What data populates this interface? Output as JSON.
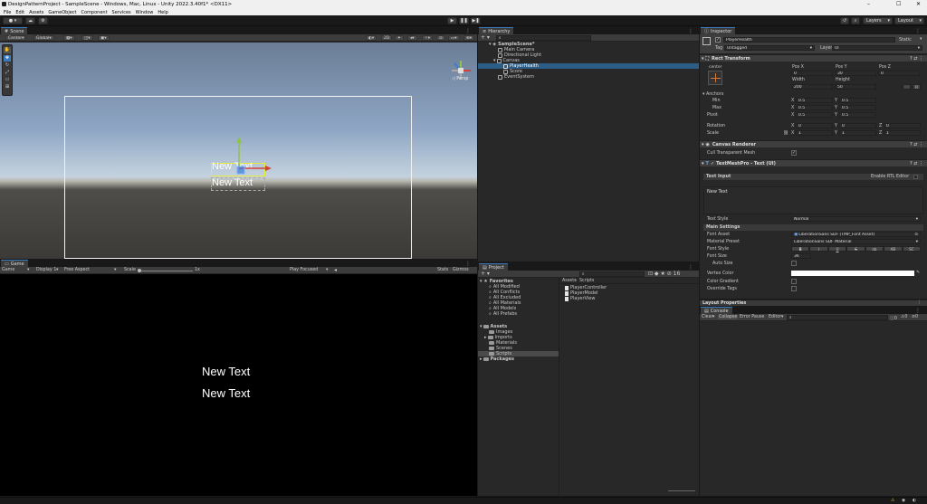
{
  "window": {
    "title": "DesignPatternProject - SampleScene - Windows, Mac, Linux - Unity 2022.3.40f1* <DX11>"
  },
  "menu": [
    "File",
    "Edit",
    "Assets",
    "GameObject",
    "Component",
    "Services",
    "Window",
    "Help"
  ],
  "toolbar": {
    "layers": "Layers",
    "layout": "Layout"
  },
  "scene": {
    "tab": "Scene",
    "pivot": "Center",
    "space": "Global",
    "mode2d": "2D",
    "persp": "◁ Persp",
    "text1": "New Text",
    "text2": "New Text"
  },
  "game": {
    "tab": "Game",
    "mode": "Game",
    "display": "Display 1",
    "aspect": "Free Aspect",
    "scale_label": "Scale",
    "scale_value": "1x",
    "play": "Play Focused",
    "stats": "Stats",
    "gizmos": "Gizmos",
    "text1": "New Text",
    "text2": "New Text"
  },
  "hierarchy": {
    "tab": "Hierarchy",
    "items": [
      {
        "label": "SampleScene*",
        "depth": 0
      },
      {
        "label": "Main Camera",
        "depth": 1
      },
      {
        "label": "Directional Light",
        "depth": 1
      },
      {
        "label": "Canvas",
        "depth": 1
      },
      {
        "label": "PlayerHealth",
        "depth": 2,
        "selected": true
      },
      {
        "label": "Score",
        "depth": 2
      },
      {
        "label": "EventSystem",
        "depth": 1
      }
    ]
  },
  "project": {
    "tab": "Project",
    "favorites": "Favorites",
    "fav_items": [
      "All Modified",
      "All Conflicts",
      "All Excluded",
      "All Materials",
      "All Models",
      "All Prefabs"
    ],
    "assets": "Assets",
    "asset_items": [
      "Images",
      "Imports",
      "Materials",
      "Scenes",
      "Scripts"
    ],
    "packages": "Packages",
    "breadcrumb": [
      "Assets",
      "Scripts"
    ],
    "files": [
      "PlayerController",
      "PlayerModel",
      "PlayerView"
    ]
  },
  "inspector": {
    "tab": "Inspector",
    "name": "PlayerHealth",
    "static": "Static",
    "tag_label": "Tag",
    "tag": "Untagged",
    "layer_label": "Layer",
    "layer": "UI",
    "rect": {
      "title": "Rect Transform",
      "center": "center",
      "posx_l": "Pos X",
      "posy_l": "Pos Y",
      "posz_l": "Pos Z",
      "posx": "0",
      "posy": "30",
      "posz": "0",
      "width_l": "Width",
      "height_l": "Height",
      "width": "200",
      "height": "50",
      "anchors": "Anchors",
      "min": "Min",
      "max": "Max",
      "pivot": "Pivot",
      "minx": "0.5",
      "miny": "0.5",
      "maxx": "0.5",
      "maxy": "0.5",
      "pivx": "0.5",
      "pivy": "0.5",
      "rotation": "Rotation",
      "scale": "Scale",
      "rotx": "0",
      "roty": "0",
      "rotz": "0",
      "scx": "1",
      "scy": "1",
      "scz": "1",
      "x": "X",
      "y": "Y",
      "z": "Z"
    },
    "canvas_renderer": "Canvas Renderer",
    "cull": "Cull Transparent Mesh",
    "tmp": {
      "title": "TextMeshPro - Text (UI)",
      "text_input": "Text Input",
      "rtl": "Enable RTL Editor",
      "text": "New Text",
      "text_style_l": "Text Style",
      "text_style": "Normal",
      "main_settings": "Main Settings",
      "font_asset_l": "Font Asset",
      "font_asset": "LiberationSans SDF (TMP_Font Asset)",
      "material_l": "Material Preset",
      "material": "LiberationSans SDF Material",
      "font_style_l": "Font Style",
      "styles": [
        "B",
        "I",
        "U",
        "S",
        "ab",
        "AB",
        "SC"
      ],
      "font_size_l": "Font Size",
      "font_size": "36",
      "auto_size": "Auto Size",
      "vertex_color": "Vertex Color",
      "color_gradient": "Color Gradient",
      "override_tags": "Override Tags"
    },
    "layout_props": "Layout Properties"
  },
  "console": {
    "tab": "Console",
    "clear": "Clear",
    "collapse": "Collapse",
    "error_pause": "Error Pause",
    "editor": "Editor",
    "c1": "0",
    "c2": "0",
    "c3": "0"
  }
}
